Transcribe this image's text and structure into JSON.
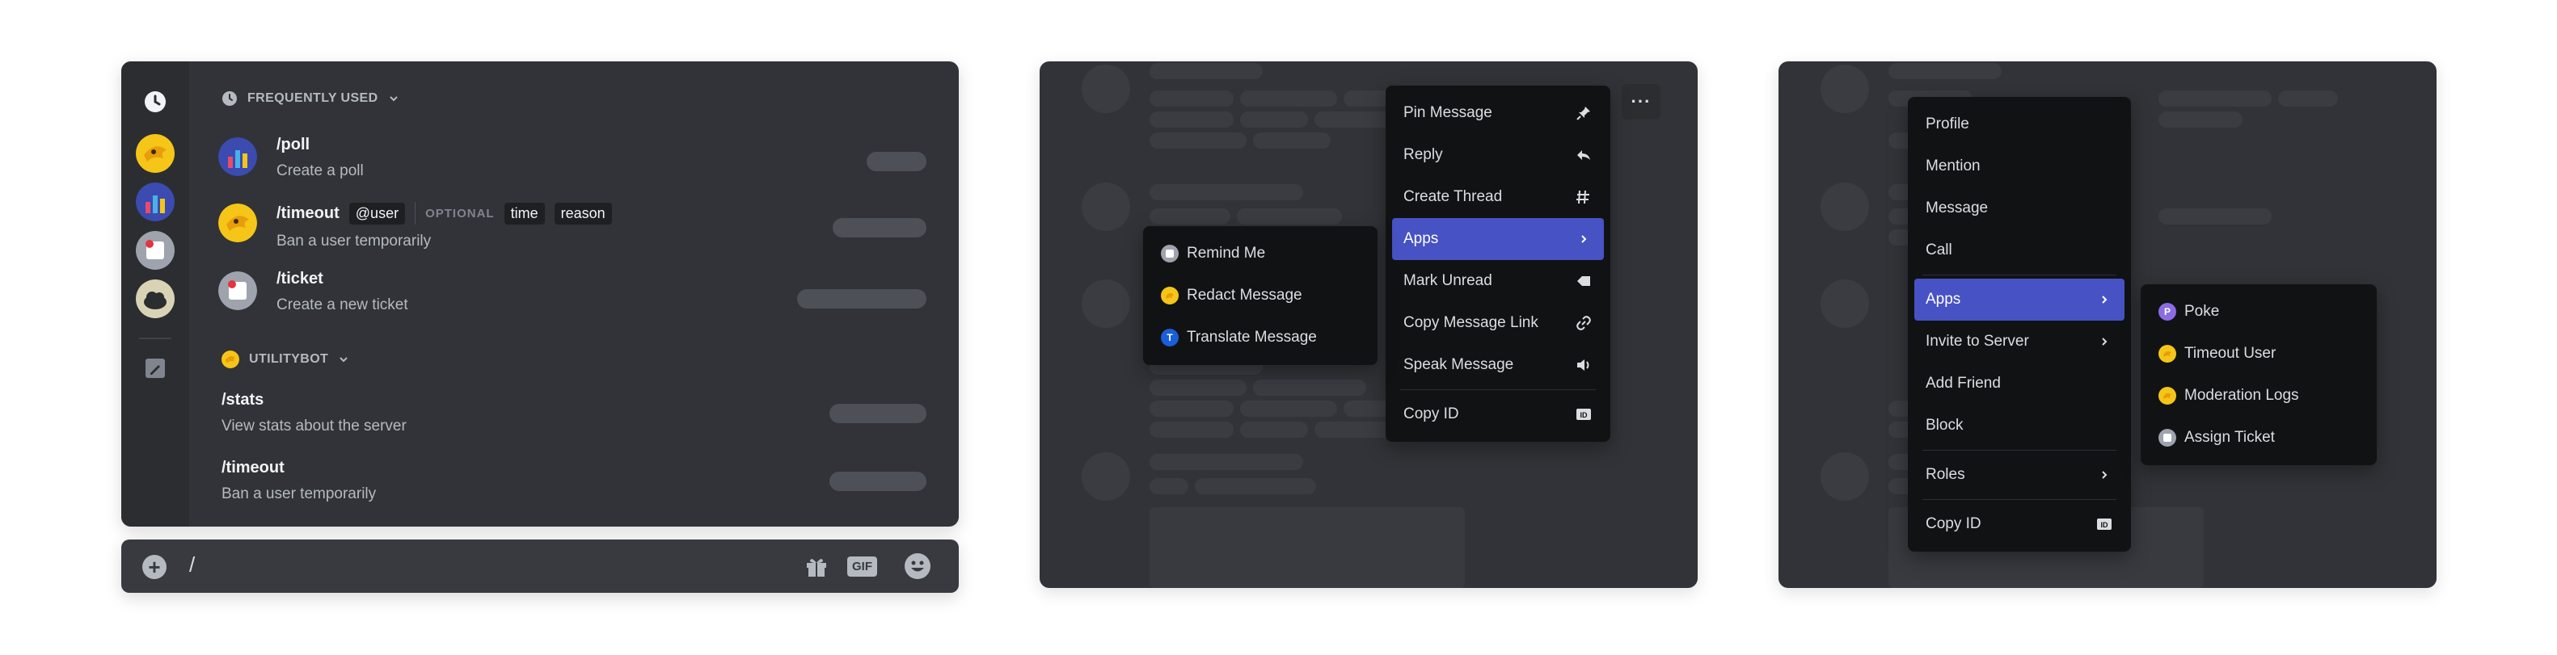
{
  "panel1": {
    "frequently_used": "FREQUENTLY USED",
    "utilitybot": "UTILITYBOT",
    "commands": [
      {
        "name": "/poll",
        "desc": "Create a poll"
      },
      {
        "name": "/timeout",
        "desc": "Ban a user temporarily",
        "options": [
          "@user",
          "OPTIONAL",
          "time",
          "reason"
        ]
      },
      {
        "name": "/ticket",
        "desc": "Create a new ticket"
      }
    ],
    "bot_commands": [
      {
        "name": "/stats",
        "desc": "View stats about the server"
      },
      {
        "name": "/timeout",
        "desc": "Ban a user temporarily"
      }
    ],
    "input_value": "/",
    "gif_label": "GIF"
  },
  "panel2": {
    "menu": [
      "Pin Message",
      "Reply",
      "Create Thread",
      "Apps",
      "Mark Unread",
      "Copy Message Link",
      "Speak Message",
      "Copy ID"
    ],
    "apps_submenu": [
      {
        "label": "Remind Me"
      },
      {
        "label": "Redact Message"
      },
      {
        "label": "Translate Message",
        "badge": "T"
      }
    ],
    "more_label": "···"
  },
  "panel3": {
    "menu": [
      "Profile",
      "Mention",
      "Message",
      "Call",
      "Apps",
      "Invite to Server",
      "Add Friend",
      "Block",
      "Roles",
      "Copy ID"
    ],
    "apps_submenu": [
      {
        "label": "Poke",
        "badge": "P"
      },
      {
        "label": "Timeout User"
      },
      {
        "label": "Moderation Logs"
      },
      {
        "label": "Assign Ticket"
      }
    ]
  },
  "colors": {
    "background": "#313338",
    "menu": "#111214",
    "active": "#4752c4",
    "accent_yellow": "#f5c518",
    "translate_blue": "#1a5fd8",
    "poke_purple": "#8b6ce3"
  },
  "icons": [
    "clock-icon",
    "pencil-icon",
    "chevron-down-icon",
    "pin-icon",
    "reply-icon",
    "thread-icon",
    "chevron-right-icon",
    "mark-unread-icon",
    "link-icon",
    "speaker-icon",
    "id-icon",
    "gift-icon",
    "gif-icon",
    "emoji-icon",
    "plus-icon"
  ]
}
